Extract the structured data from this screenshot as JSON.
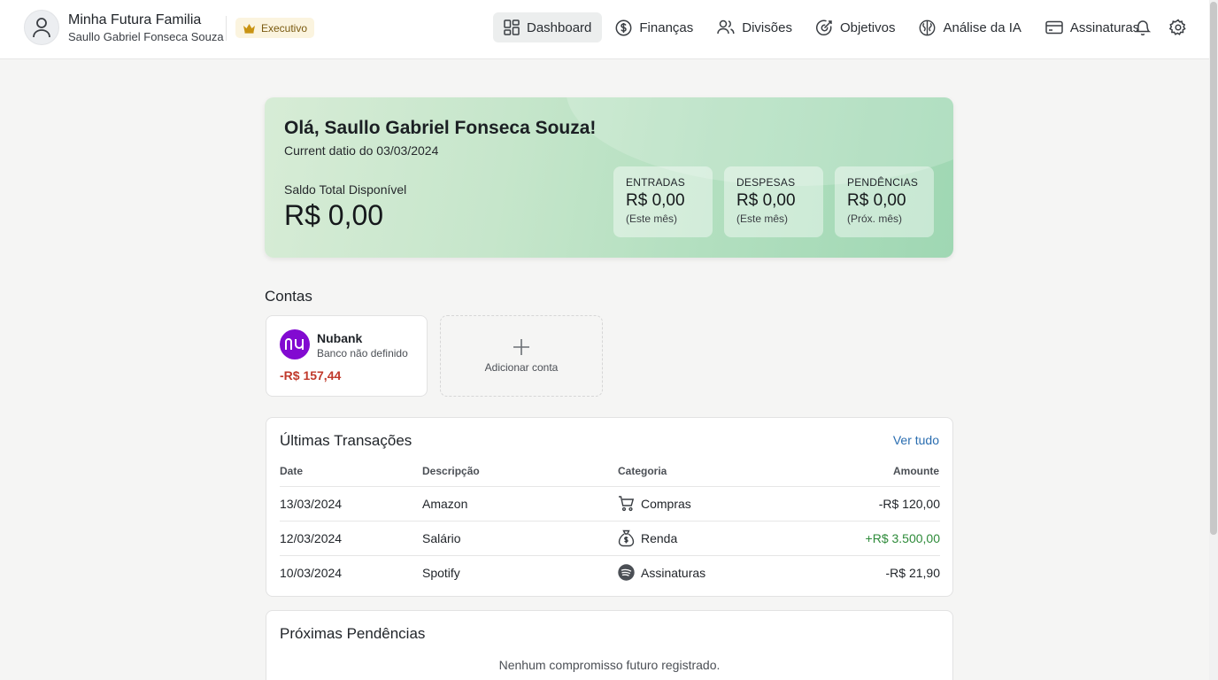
{
  "header": {
    "family_name": "Minha Futura Familia",
    "user_name": "Saullo Gabriel Fonseca Souza",
    "plan_badge": "Executivo",
    "nav": [
      {
        "label": "Dashboard",
        "icon": "dashboard-icon",
        "active": true
      },
      {
        "label": "Finanças",
        "icon": "dollar-icon"
      },
      {
        "label": "Divisões",
        "icon": "users-icon"
      },
      {
        "label": "Objetivos",
        "icon": "target-icon"
      },
      {
        "label": "Análise da IA",
        "icon": "brain-icon"
      },
      {
        "label": "Assinaturas",
        "icon": "credit-card-icon"
      }
    ],
    "actions": [
      "bell-icon",
      "gear-icon"
    ]
  },
  "hero": {
    "greeting": "Olá, Saullo Gabriel Fonseca Souza!",
    "date_line": "Current datio do 03/03/2024",
    "balance_label": "Saldo Total Disponível",
    "balance_value": "R$ 0,00",
    "stats": [
      {
        "label": "ENTRADAS",
        "value": "R$ 0,00",
        "sub": "(Este mês)"
      },
      {
        "label": "DESPESAS",
        "value": "R$ 0,00",
        "sub": "(Este mês)"
      },
      {
        "label": "PENDÊNCIAS",
        "value": "R$ 0,00",
        "sub": "(Próx. mês)"
      }
    ]
  },
  "accounts": {
    "title": "Contas",
    "items": [
      {
        "name": "Nubank",
        "subtitle": "Banco não definido",
        "balance": "-R$ 157,44"
      }
    ],
    "add_label": "Adicionar conta"
  },
  "transactions": {
    "title": "Últimas Transações",
    "see_all": "Ver tudo",
    "columns": [
      "Date",
      "Descripção",
      "Categoria",
      "Amounte"
    ],
    "rows": [
      {
        "date": "13/03/2024",
        "description": "Amazon",
        "category": "Compras",
        "category_icon": "cart-icon",
        "amount": "-R$ 120,00",
        "type": "neg"
      },
      {
        "date": "12/03/2024",
        "description": "Salário",
        "category": "Renda",
        "category_icon": "money-bag-icon",
        "amount": "+R$ 3.500,00",
        "type": "pos"
      },
      {
        "date": "10/03/2024",
        "description": "Spotify",
        "category": "Assinaturas",
        "category_icon": "spotify-icon",
        "amount": "-R$ 21,90",
        "type": "neg"
      }
    ]
  },
  "pending": {
    "title": "Próximas Pendências",
    "empty": "Nenhum compromisso futuro registrado."
  },
  "colors": {
    "accent_green": "#b2dfbf",
    "negative": "#c0392b",
    "positive": "#2e8b3a",
    "link": "#2a6db0",
    "nubank": "#820ad1"
  }
}
